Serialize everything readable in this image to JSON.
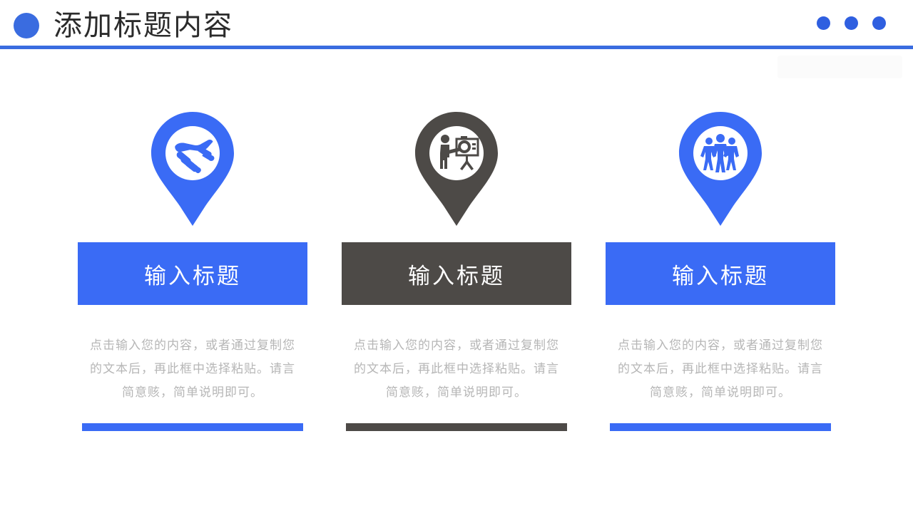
{
  "header": {
    "title": "添加标题内容",
    "bullet_icon": "circle-bullet-icon",
    "dots": [
      "dot-1",
      "dot-2",
      "dot-3"
    ],
    "accent_color": "#3a6ce0",
    "rule_color": "#3a6ce0"
  },
  "theme": {
    "background": "#ffffff",
    "blue": "#3a6bf5",
    "gray": "#4d4a47",
    "body_text": "#b6b6b6",
    "title_text": "#2b2b2b"
  },
  "columns": [
    {
      "icon": "handshake-pin-icon",
      "pin_color": "#3a6bf5",
      "title": "输入标题",
      "title_bg": "#3a6bf5",
      "body": "点击输入您的内容，或者通过复制您的文本后，再此框中选择粘贴。请言简意赅，简单说明即可。",
      "rule_color": "#3a6bf5"
    },
    {
      "icon": "presenter-board-pin-icon",
      "pin_color": "#4d4a47",
      "title": "输入标题",
      "title_bg": "#4d4a47",
      "body": "点击输入您的内容，或者通过复制您的文本后，再此框中选择粘贴。请言简意赅，简单说明即可。",
      "rule_color": "#4d4a47"
    },
    {
      "icon": "group-people-pin-icon",
      "pin_color": "#3a6bf5",
      "title": "输入标题",
      "title_bg": "#3a6bf5",
      "body": "点击输入您的内容，或者通过复制您的文本后，再此框中选择粘贴。请言简意赅，简单说明即可。",
      "rule_color": "#3a6bf5"
    }
  ]
}
